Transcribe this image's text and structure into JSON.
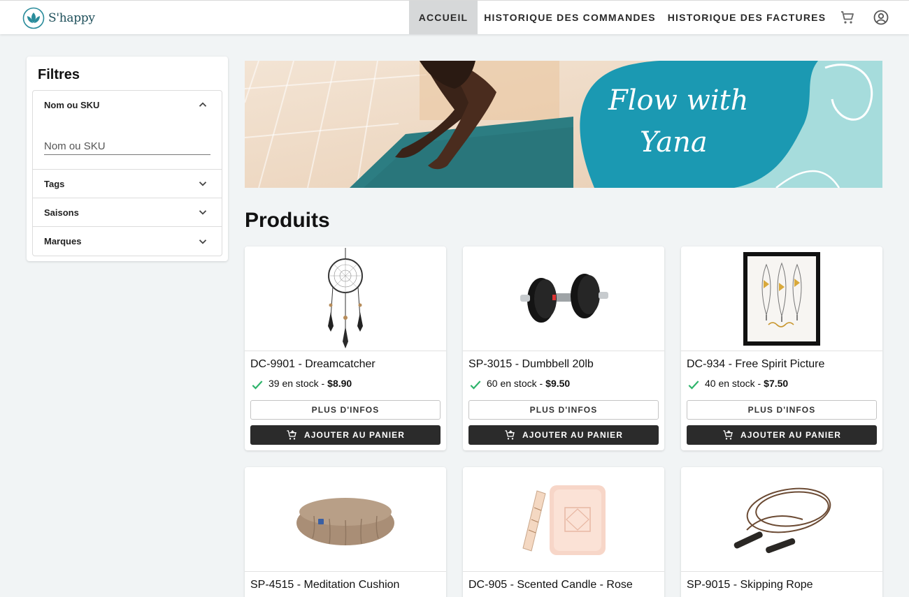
{
  "brand": {
    "name": "S'happy",
    "accent": "#2a8c9b",
    "dark": "#1e4f5a"
  },
  "nav": {
    "items": [
      {
        "label": "ACCUEIL",
        "active": true
      },
      {
        "label": "HISTORIQUE DES COMMANDES",
        "active": false
      },
      {
        "label": "HISTORIQUE DES FACTURES",
        "active": false
      }
    ],
    "icons": [
      "cart-icon",
      "account-icon"
    ]
  },
  "filters": {
    "title": "Filtres",
    "sections": [
      {
        "label": "Nom ou SKU",
        "expanded": true,
        "input_placeholder": "Nom ou SKU",
        "input_value": ""
      },
      {
        "label": "Tags",
        "expanded": false
      },
      {
        "label": "Saisons",
        "expanded": false
      },
      {
        "label": "Marques",
        "expanded": false
      }
    ]
  },
  "banner": {
    "text_line1": "Flow with",
    "text_line2": "Yana"
  },
  "products_section": {
    "title": "Produits",
    "more_label": "PLUS D'INFOS",
    "add_label": "AJOUTER AU PANIER",
    "items": [
      {
        "name": "DC-9901 - Dreamcatcher",
        "stock": "39 en stock -",
        "price": "$8.90",
        "image": "dreamcatcher"
      },
      {
        "name": "SP-3015 - Dumbbell 20lb",
        "stock": "60 en stock -",
        "price": "$9.50",
        "image": "dumbbell"
      },
      {
        "name": "DC-934 - Free Spirit Picture",
        "stock": "40 en stock -",
        "price": "$7.50",
        "image": "framed-picture"
      },
      {
        "name": "SP-4515 - Meditation Cushion",
        "image": "meditation-cushion"
      },
      {
        "name": "DC-905 - Scented Candle - Rose",
        "image": "scented-candle"
      },
      {
        "name": "SP-9015 - Skipping Rope",
        "image": "skipping-rope"
      }
    ]
  }
}
